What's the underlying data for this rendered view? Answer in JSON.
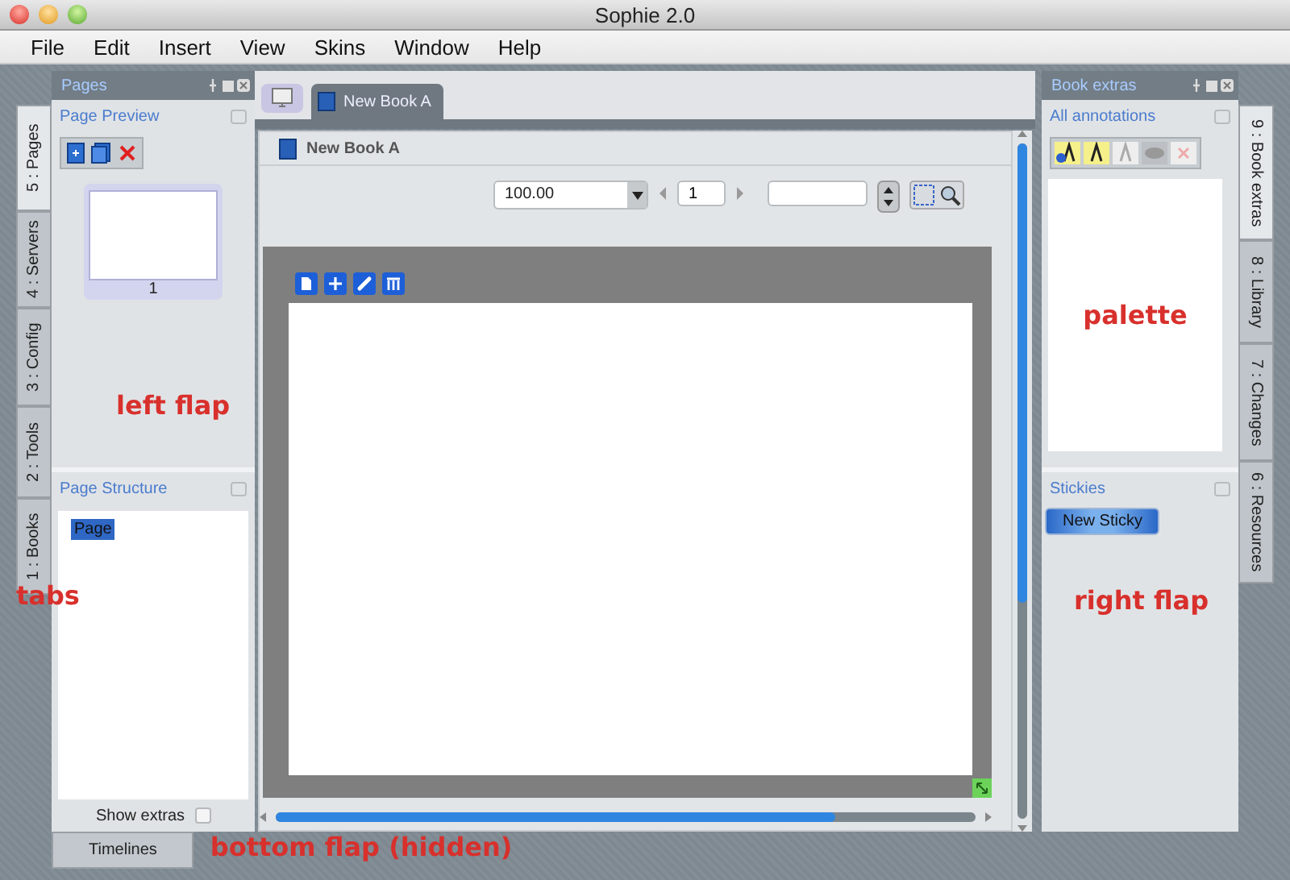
{
  "window": {
    "title": "Sophie 2.0"
  },
  "menu": [
    {
      "label": "File"
    },
    {
      "label": "Edit"
    },
    {
      "label": "Insert"
    },
    {
      "label": "View"
    },
    {
      "label": "Skins"
    },
    {
      "label": "Window"
    },
    {
      "label": "Help"
    }
  ],
  "left_tabs": [
    {
      "label": "5 : Pages",
      "selected": true
    },
    {
      "label": "4 : Servers",
      "selected": false
    },
    {
      "label": "3 : Config",
      "selected": false
    },
    {
      "label": "2 : Tools",
      "selected": false
    },
    {
      "label": "1 : Books",
      "selected": false
    }
  ],
  "left_flap": {
    "title": "Pages",
    "page_preview": {
      "title": "Page Preview",
      "pages": [
        {
          "label": "1",
          "selected": true
        }
      ]
    },
    "page_structure": {
      "title": "Page Structure",
      "items": [
        {
          "label": "Page",
          "selected": true
        }
      ]
    },
    "show_extras": {
      "label": "Show extras",
      "checked": false
    }
  },
  "bottom_tabs": [
    {
      "label": "Timelines",
      "selected": false
    }
  ],
  "document_tabs": [
    {
      "label": "New Book A",
      "selected": true
    }
  ],
  "document": {
    "title": "New Book A",
    "zoom": "100.00",
    "page": "1"
  },
  "right_tabs": [
    {
      "label": "9 : Book extras",
      "selected": true
    },
    {
      "label": "8 : Library",
      "selected": false
    },
    {
      "label": "7 : Changes",
      "selected": false
    },
    {
      "label": "6 : Resources",
      "selected": false
    }
  ],
  "right_flap": {
    "title": "Book extras",
    "annotations": {
      "title": "All annotations"
    },
    "stickies": {
      "title": "Stickies",
      "button": "New Sticky"
    }
  },
  "overlay_labels": {
    "left_flap": "left flap",
    "tabs": "tabs",
    "palette": "palette",
    "right_flap": "right flap",
    "bottom_flap": "bottom flap (hidden)"
  }
}
